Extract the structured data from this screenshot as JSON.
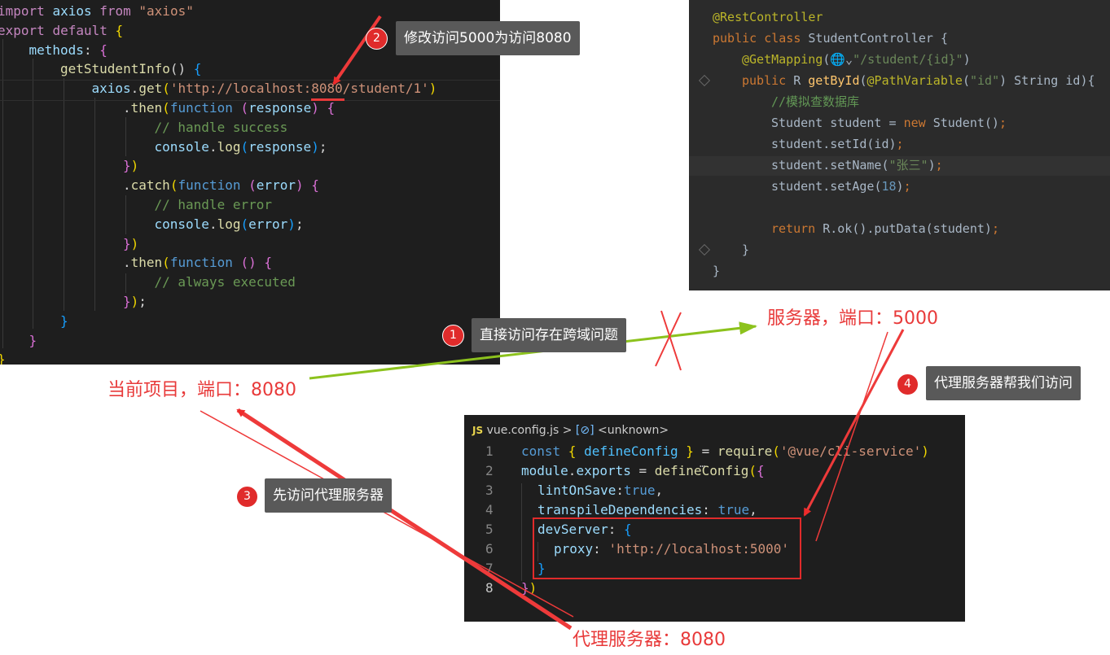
{
  "left_code": {
    "lines": [
      [
        [
          "import ",
          "#c586c0"
        ],
        [
          "axios ",
          "#9cdcfe"
        ],
        [
          "from ",
          "#c586c0"
        ],
        [
          "\"axios\"",
          "#ce9178"
        ]
      ],
      [
        [
          "export ",
          "#c586c0"
        ],
        [
          "default ",
          "#c586c0"
        ],
        [
          "{",
          "#f1d700"
        ]
      ],
      [
        [
          "methods",
          "#9cdcfe"
        ],
        [
          ": ",
          "#d4d4d4"
        ],
        [
          "{",
          "#da70d6"
        ]
      ],
      [
        [
          "getStudentInfo",
          "#dcdcaa"
        ],
        [
          "() ",
          "#d4d4d4"
        ],
        [
          "{",
          "#179fff"
        ]
      ],
      [
        [
          "axios",
          "#9cdcfe"
        ],
        [
          ".",
          "#d4d4d4"
        ],
        [
          "get",
          "#dcdcaa"
        ],
        [
          "(",
          "#f1d700"
        ],
        [
          "'http://localhost:",
          "#ce9178"
        ],
        [
          "8080",
          "#ce9178"
        ],
        [
          "/student/1'",
          "#ce9178"
        ],
        [
          ")",
          "#f1d700"
        ]
      ],
      [
        [
          ".",
          "#d4d4d4"
        ],
        [
          "then",
          "#dcdcaa"
        ],
        [
          "(",
          "#f1d700"
        ],
        [
          "function ",
          "#569cd6"
        ],
        [
          "(",
          "#da70d6"
        ],
        [
          "response",
          "#9cdcfe"
        ],
        [
          ") ",
          "#da70d6"
        ],
        [
          "{",
          "#da70d6"
        ]
      ],
      [
        [
          "// handle success",
          "#6a9955"
        ]
      ],
      [
        [
          "console",
          "#9cdcfe"
        ],
        [
          ".",
          "#d4d4d4"
        ],
        [
          "log",
          "#dcdcaa"
        ],
        [
          "(",
          "#179fff"
        ],
        [
          "response",
          "#9cdcfe"
        ],
        [
          ")",
          "#179fff"
        ],
        [
          ";",
          "#d4d4d4"
        ]
      ],
      [
        [
          "}",
          "#da70d6"
        ],
        [
          ")",
          "#f1d700"
        ]
      ],
      [
        [
          ".",
          "#d4d4d4"
        ],
        [
          "catch",
          "#dcdcaa"
        ],
        [
          "(",
          "#f1d700"
        ],
        [
          "function ",
          "#569cd6"
        ],
        [
          "(",
          "#da70d6"
        ],
        [
          "error",
          "#9cdcfe"
        ],
        [
          ") ",
          "#da70d6"
        ],
        [
          "{",
          "#da70d6"
        ]
      ],
      [
        [
          "// handle error",
          "#6a9955"
        ]
      ],
      [
        [
          "console",
          "#9cdcfe"
        ],
        [
          ".",
          "#d4d4d4"
        ],
        [
          "log",
          "#dcdcaa"
        ],
        [
          "(",
          "#179fff"
        ],
        [
          "error",
          "#9cdcfe"
        ],
        [
          ")",
          "#179fff"
        ],
        [
          ";",
          "#d4d4d4"
        ]
      ],
      [
        [
          "}",
          "#da70d6"
        ],
        [
          ")",
          "#f1d700"
        ]
      ],
      [
        [
          ".",
          "#d4d4d4"
        ],
        [
          "then",
          "#dcdcaa"
        ],
        [
          "(",
          "#f1d700"
        ],
        [
          "function ",
          "#569cd6"
        ],
        [
          "() ",
          "#da70d6"
        ],
        [
          "{",
          "#da70d6"
        ]
      ],
      [
        [
          "// always executed",
          "#6a9955"
        ]
      ],
      [
        [
          "}",
          "#da70d6"
        ],
        [
          ")",
          "#f1d700"
        ],
        [
          ";",
          "#d4d4d4"
        ]
      ],
      [
        [
          "}",
          "#179fff"
        ]
      ],
      [
        [
          "}",
          "#da70d6"
        ]
      ],
      [
        [
          "}",
          "#f1d700"
        ]
      ]
    ]
  },
  "right_code": {
    "lines": [
      [
        [
          "@RestController",
          "#bbb529"
        ]
      ],
      [
        [
          "public ",
          "#cc7832"
        ],
        [
          "class ",
          "#cc7832"
        ],
        [
          "StudentController ",
          "#a9b7c6"
        ],
        [
          "{",
          "#a9b7c6"
        ]
      ],
      [
        [
          "@GetMapping",
          "#bbb529"
        ],
        [
          "(",
          "#a9b7c6"
        ],
        [
          "🌐⌄",
          "#a9b7c6"
        ],
        [
          "\"",
          "#6a8759"
        ],
        [
          "/student/{id}",
          "#6a8759"
        ],
        [
          "\"",
          "#6a8759"
        ],
        [
          ")",
          "#a9b7c6"
        ]
      ],
      [
        [
          "public ",
          "#cc7832"
        ],
        [
          "R ",
          "#a9b7c6"
        ],
        [
          "getById",
          "#ffc66d"
        ],
        [
          "(",
          "#a9b7c6"
        ],
        [
          "@PathVariable",
          "#bbb529"
        ],
        [
          "(",
          "#a9b7c6"
        ],
        [
          "\"",
          "#6a8759"
        ],
        [
          "id",
          "#6a8759"
        ],
        [
          "\"",
          "#6a8759"
        ],
        [
          ") ",
          "#a9b7c6"
        ],
        [
          "String ",
          "#a9b7c6"
        ],
        [
          "id",
          "#a9b7c6"
        ],
        [
          "){",
          "#a9b7c6"
        ]
      ],
      [
        [
          "//模拟查数据库",
          "#629755"
        ]
      ],
      [
        [
          "Student ",
          "#a9b7c6"
        ],
        [
          "student ",
          "#a9b7c6"
        ],
        [
          "= ",
          "#a9b7c6"
        ],
        [
          "new ",
          "#cc7832"
        ],
        [
          "Student",
          "#a9b7c6"
        ],
        [
          "()",
          "#a9b7c6"
        ],
        [
          ";",
          "#cc7832"
        ]
      ],
      [
        [
          "student.setId",
          "#a9b7c6"
        ],
        [
          "(id)",
          "#a9b7c6"
        ],
        [
          ";",
          "#cc7832"
        ]
      ],
      [
        [
          "student.setName",
          "#a9b7c6"
        ],
        [
          "(",
          "#a9b7c6"
        ],
        [
          "\"张三\"",
          "#6a8759"
        ],
        [
          ")",
          "#a9b7c6"
        ],
        [
          ";",
          "#cc7832"
        ]
      ],
      [
        [
          "student.setAge",
          "#a9b7c6"
        ],
        [
          "(",
          "#a9b7c6"
        ],
        [
          "18",
          "#6897bb"
        ],
        [
          ")",
          "#a9b7c6"
        ],
        [
          ";",
          "#cc7832"
        ]
      ],
      [],
      [
        [
          "return ",
          "#cc7832"
        ],
        [
          "R.",
          "#a9b7c6"
        ],
        [
          "ok",
          "#a9b7c6"
        ],
        [
          "().putData(student)",
          "#a9b7c6"
        ],
        [
          ";",
          "#cc7832"
        ]
      ],
      [
        [
          "}",
          "#a9b7c6"
        ]
      ],
      [
        [
          "}",
          "#a9b7c6"
        ]
      ]
    ]
  },
  "vue_config": {
    "breadcrumb_file": "vue.config.js",
    "breadcrumb_sep": ">",
    "breadcrumb_symbol": "<unknown>",
    "js_badge": "JS",
    "line_numbers": [
      "1",
      "2",
      "3",
      "4",
      "5",
      "6",
      "7",
      "8"
    ],
    "lines": [
      [
        [
          "const ",
          "#569cd6"
        ],
        [
          "{ ",
          "#f1d700"
        ],
        [
          "defineConfig ",
          "#4fc1ff"
        ],
        [
          "} ",
          "#f1d700"
        ],
        [
          "= ",
          "#d4d4d4"
        ],
        [
          "require",
          "#dcdcaa"
        ],
        [
          "(",
          "#f1d700"
        ],
        [
          "'@vue/cli-service'",
          "#ce9178"
        ],
        [
          ")",
          "#f1d700"
        ]
      ],
      [
        [
          "module",
          "#9cdcfe"
        ],
        [
          ".",
          "#d4d4d4"
        ],
        [
          "exports ",
          "#9cdcfe"
        ],
        [
          "= ",
          "#d4d4d4"
        ],
        [
          "defineConfig",
          "#dcdcaa"
        ],
        [
          "(",
          "#f1d700"
        ],
        [
          "{",
          "#da70d6"
        ]
      ],
      [
        [
          "lintOnSave",
          "#9cdcfe"
        ],
        [
          ":",
          "#d4d4d4"
        ],
        [
          "true",
          "#569cd6"
        ],
        [
          ",",
          "#d4d4d4"
        ]
      ],
      [
        [
          "transpileDependencies",
          "#9cdcfe"
        ],
        [
          ": ",
          "#d4d4d4"
        ],
        [
          "true",
          "#569cd6"
        ],
        [
          ",",
          "#d4d4d4"
        ]
      ],
      [
        [
          "devServer",
          "#9cdcfe"
        ],
        [
          ": ",
          "#d4d4d4"
        ],
        [
          "{",
          "#179fff"
        ]
      ],
      [
        [
          "proxy",
          "#9cdcfe"
        ],
        [
          ": ",
          "#d4d4d4"
        ],
        [
          "'http://localhost:5000'",
          "#ce9178"
        ]
      ],
      [
        [
          "}",
          "#179fff"
        ]
      ],
      [
        [
          "}",
          "#da70d6"
        ],
        [
          ")",
          "#f1d700"
        ]
      ]
    ]
  },
  "annotations": [
    {
      "number": "1",
      "text": "直接访问存在跨域问题"
    },
    {
      "number": "2",
      "text": "修改访问5000为访问8080"
    },
    {
      "number": "3",
      "text": "先访问代理服务器"
    },
    {
      "number": "4",
      "text": "代理服务器帮我们访问"
    }
  ],
  "labels": {
    "current_project": "当前项目，端口：8080",
    "server": "服务器，端口：5000",
    "proxy_server": "代理服务器：8080"
  },
  "colors": {
    "annotation_red": "#e83a3a",
    "arrow_green": "#8cc21d",
    "vscode_bg": "#1e1e1e",
    "idea_bg": "#2b2b2b"
  }
}
